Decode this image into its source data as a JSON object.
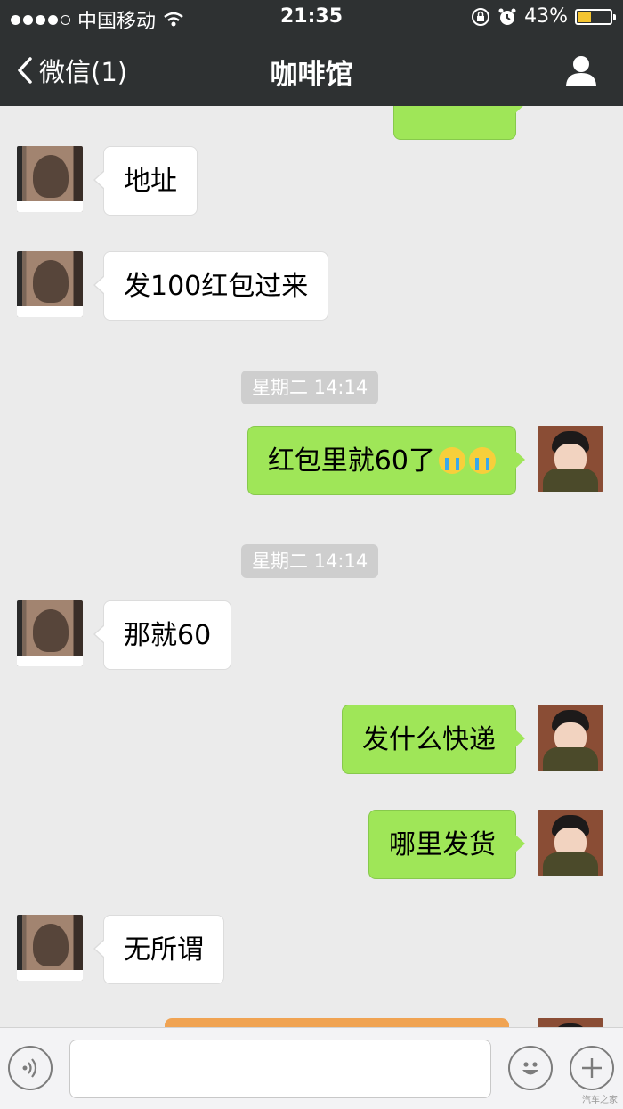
{
  "status_bar": {
    "carrier": "中国移动",
    "time": "21:35",
    "battery_percent": "43%",
    "battery_level": 0.43
  },
  "nav": {
    "back_label": "微信(1)",
    "title": "咖啡馆"
  },
  "messages": [
    {
      "text": "地址"
    },
    {
      "text": "发100红包过来"
    },
    {
      "text": "红包里就60了"
    },
    {
      "text": "那就60"
    },
    {
      "text": "发什么快递"
    },
    {
      "text": "哪里发货"
    },
    {
      "text": "无所谓"
    }
  ],
  "timestamps": [
    "星期二 14:14",
    "星期二 14:14"
  ],
  "icons": {
    "back": "chevron-left-icon",
    "profile": "person-icon",
    "voice": "voice-icon",
    "emoji": "smiley-icon",
    "plus": "plus-icon"
  },
  "colors": {
    "nav_bg": "#2e3132",
    "chat_bg": "#ebebeb",
    "bubble_out": "#9fe658",
    "bubble_in": "#ffffff",
    "battery": "#f4c430",
    "partial_card": "#f0a352"
  },
  "watermark": "汽车之家"
}
